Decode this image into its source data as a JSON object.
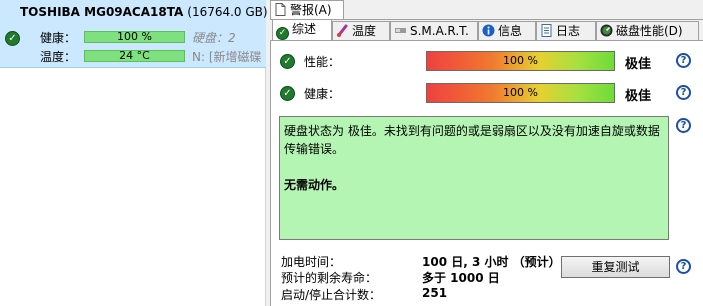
{
  "drive": {
    "name": "TOSHIBA MG09ACA18TA",
    "size": "(16764.0 GB)",
    "health_label": "健康：",
    "health_value": "100 %",
    "temp_label": "温度：",
    "temp_value": "24 °C",
    "disk_label": "硬盘：2",
    "volume_label": "N: [新增磁碟"
  },
  "tabs": {
    "alert": "警报(A)",
    "items": [
      "综述",
      "温度",
      "S.M.A.R.T.",
      "信息",
      "日志",
      "磁盘性能(D)"
    ]
  },
  "overview": {
    "performance_label": "性能：",
    "performance_value": "100 %",
    "performance_fraction": 1.0,
    "performance_rating": "极佳",
    "health_label": "健康：",
    "health_value": "100 %",
    "health_fraction": 1.0,
    "health_rating": "极佳",
    "status_text": "硬盘状态为 极佳。未找到有问题的或是弱扇区以及没有加速自旋或数据传输错误。",
    "status_action": "无需动作。",
    "power_on_label": "加电时间：",
    "power_on_value": "100 日, 3 小时 （预计）",
    "remaining_label": "预计的剩余寿命：",
    "remaining_value": "多于 1000 日",
    "startstop_label": "启动/停止合计数：",
    "startstop_value": "251",
    "retest_button": "重复测试"
  },
  "colors": {
    "selection": "#cce8ff",
    "status_bg": "#b4f5b4",
    "ok_green": "#1f7a2e",
    "help_blue": "#1a4ea8"
  },
  "icons": [
    "check-icon",
    "document-icon",
    "thermometer-icon",
    "smart-drive-icon",
    "info-icon",
    "log-icon",
    "gauge-icon",
    "help-icon"
  ]
}
